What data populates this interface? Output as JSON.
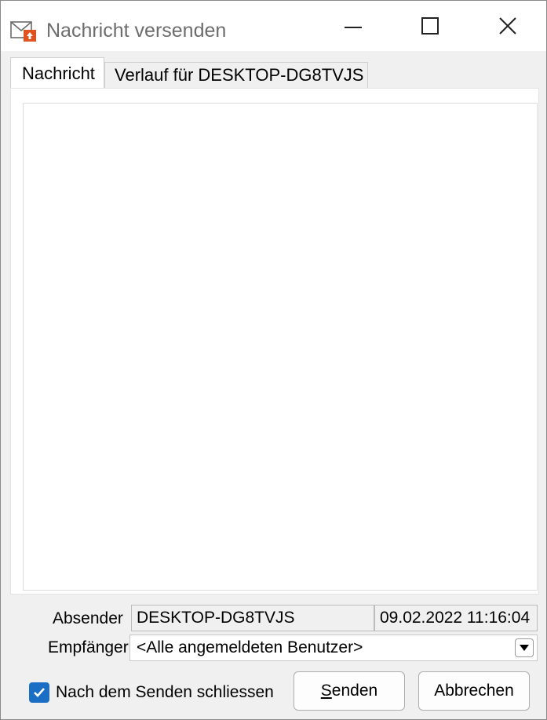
{
  "window": {
    "title": "Nachricht versenden",
    "icon": "message-send-icon",
    "controls": {
      "minimize": "minimize-icon",
      "maximize": "maximize-icon",
      "close": "close-icon"
    }
  },
  "tabs": [
    {
      "label": "Nachricht",
      "active": true
    },
    {
      "label": "Verlauf für DESKTOP-DG8TVJS",
      "active": false
    }
  ],
  "message": {
    "value": ""
  },
  "sender": {
    "label": "Absender",
    "value": "DESKTOP-DG8TVJS",
    "timestamp": "09.02.2022 11:16:04"
  },
  "recipient": {
    "label": "Empfänger",
    "selected": "<Alle angemeldeten Benutzer>"
  },
  "options": {
    "close_after_send_label": "Nach dem Senden schliessen",
    "close_after_send_checked": true
  },
  "buttons": {
    "send_label_mnemonic": "S",
    "send_label_rest": "enden",
    "cancel_label": "Abbrechen"
  },
  "colors": {
    "accent": "#1a6fc4",
    "icon_accent": "#e0531f"
  }
}
